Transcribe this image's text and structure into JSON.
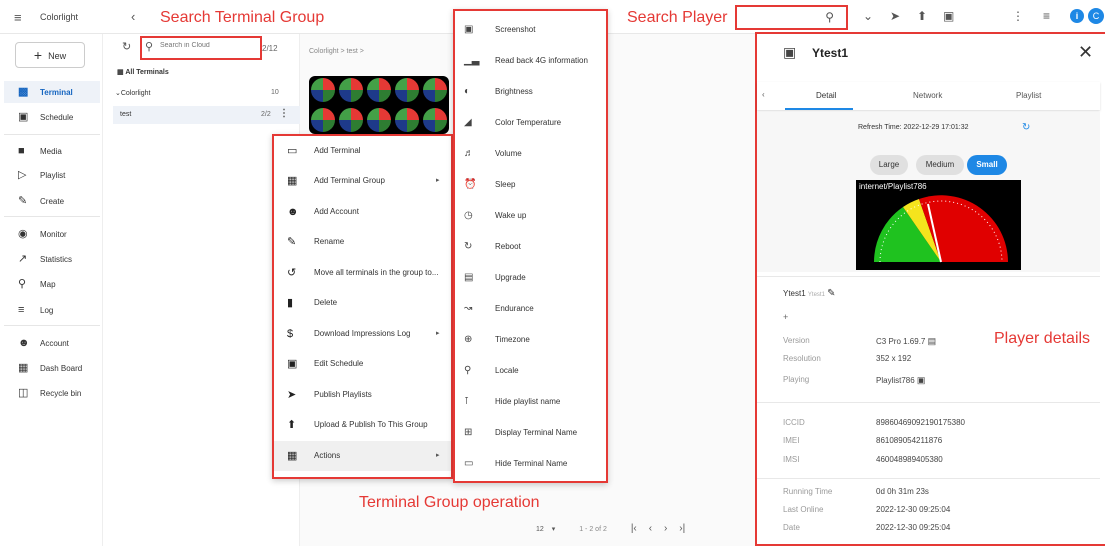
{
  "topbar": {
    "app_name": "Colorlight",
    "annotation_search_group": "Search Terminal Group",
    "annotation_search_player": "Search Player"
  },
  "sidebar": {
    "new_label": "New",
    "items": [
      {
        "label": "Terminal",
        "icon": "terminal-icon",
        "active": true
      },
      {
        "label": "Schedule",
        "icon": "calendar-icon"
      },
      {
        "label": "Media",
        "icon": "media-icon"
      },
      {
        "label": "Playlist",
        "icon": "playlist-icon"
      },
      {
        "label": "Create",
        "icon": "pencil-icon"
      },
      {
        "label": "Monitor",
        "icon": "eye-icon"
      },
      {
        "label": "Statistics",
        "icon": "trend-icon"
      },
      {
        "label": "Map",
        "icon": "map-pin-icon"
      },
      {
        "label": "Log",
        "icon": "list-icon"
      },
      {
        "label": "Account",
        "icon": "person-icon"
      },
      {
        "label": "Dash Board",
        "icon": "dashboard-icon"
      },
      {
        "label": "Recycle bin",
        "icon": "trash-icon"
      }
    ]
  },
  "group_panel": {
    "search_placeholder": "Search in Cloud",
    "count": "2/12",
    "all_terminals": "All Terminals",
    "group_name": "Colorlight",
    "group_count": "10",
    "child_name": "test",
    "child_count": "2/2"
  },
  "main": {
    "breadcrumb": "Colorlight  >  test  >",
    "pager": {
      "page_size": "12",
      "range": "1 - 2 of 2"
    }
  },
  "context_menu": {
    "annotation": "Terminal Group operation",
    "items": [
      {
        "label": "Add Terminal",
        "icon": "monitor-icon"
      },
      {
        "label": "Add Terminal Group",
        "icon": "group-icon",
        "submenu": true
      },
      {
        "label": "Add Account",
        "icon": "person-icon"
      },
      {
        "label": "Rename",
        "icon": "pencil-icon"
      },
      {
        "label": "Move all terminals in the group to...",
        "icon": "history-icon"
      },
      {
        "label": "Delete",
        "icon": "trash-icon"
      },
      {
        "label": "Download Impressions Log",
        "icon": "dollar-icon",
        "submenu": true
      },
      {
        "label": "Edit Schedule",
        "icon": "calendar-icon"
      },
      {
        "label": "Publish Playlists",
        "icon": "send-icon"
      },
      {
        "label": "Upload & Publish To This Group",
        "icon": "upload-icon"
      },
      {
        "label": "Actions",
        "icon": "grid-icon",
        "submenu": true,
        "highlighted": true
      }
    ]
  },
  "actions_menu": {
    "items": [
      {
        "label": "Screenshot",
        "icon": "screenshot-icon"
      },
      {
        "label": "Read back 4G information",
        "icon": "signal-icon"
      },
      {
        "label": "Brightness",
        "icon": "brightness-icon"
      },
      {
        "label": "Color Temperature",
        "icon": "color-temp-icon"
      },
      {
        "label": "Volume",
        "icon": "volume-icon"
      },
      {
        "label": "Sleep",
        "icon": "sleep-icon"
      },
      {
        "label": "Wake up",
        "icon": "alarm-icon"
      },
      {
        "label": "Reboot",
        "icon": "reboot-icon"
      },
      {
        "label": "Upgrade",
        "icon": "upgrade-icon"
      },
      {
        "label": "Endurance",
        "icon": "endurance-icon"
      },
      {
        "label": "Timezone",
        "icon": "globe-icon"
      },
      {
        "label": "Locale",
        "icon": "locale-icon"
      },
      {
        "label": "Hide playlist name",
        "icon": "hide-name-icon"
      },
      {
        "label": "Display Terminal Name",
        "icon": "display-name-icon"
      },
      {
        "label": "Hide Terminal Name",
        "icon": "hide-terminal-icon"
      }
    ]
  },
  "player_panel": {
    "title": "Ytest1",
    "annotation": "Player details",
    "tabs": [
      "Detail",
      "Network",
      "Playlist"
    ],
    "active_tab": "Detail",
    "refresh_time": "Refresh Time: 2022-12-29 17:01:32",
    "sizes": {
      "large": "Large",
      "medium": "Medium",
      "small": "Small",
      "selected": "Small"
    },
    "preview_caption": "internet/Playlist786",
    "name": "Ytest1",
    "alias": "Ytest1",
    "plus": "+",
    "details": [
      {
        "key": "Version",
        "value": "C3 Pro 1.69.7"
      },
      {
        "key": "Resolution",
        "value": "352 x 192"
      },
      {
        "key": "Playing",
        "value": "Playlist786"
      }
    ],
    "network": [
      {
        "key": "ICCID",
        "value": "89860469092190175380"
      },
      {
        "key": "IMEI",
        "value": "861089054211876"
      },
      {
        "key": "IMSI",
        "value": "460048989405380"
      }
    ],
    "status": [
      {
        "key": "Running Time",
        "value": "0d 0h 31m 23s"
      },
      {
        "key": "Last Online",
        "value": "2022-12-30 09:25:04"
      },
      {
        "key": "Date",
        "value": "2022-12-30 09:25:04"
      }
    ]
  },
  "colors": {
    "accent": "#1e88e5",
    "annotation": "#e53935"
  }
}
